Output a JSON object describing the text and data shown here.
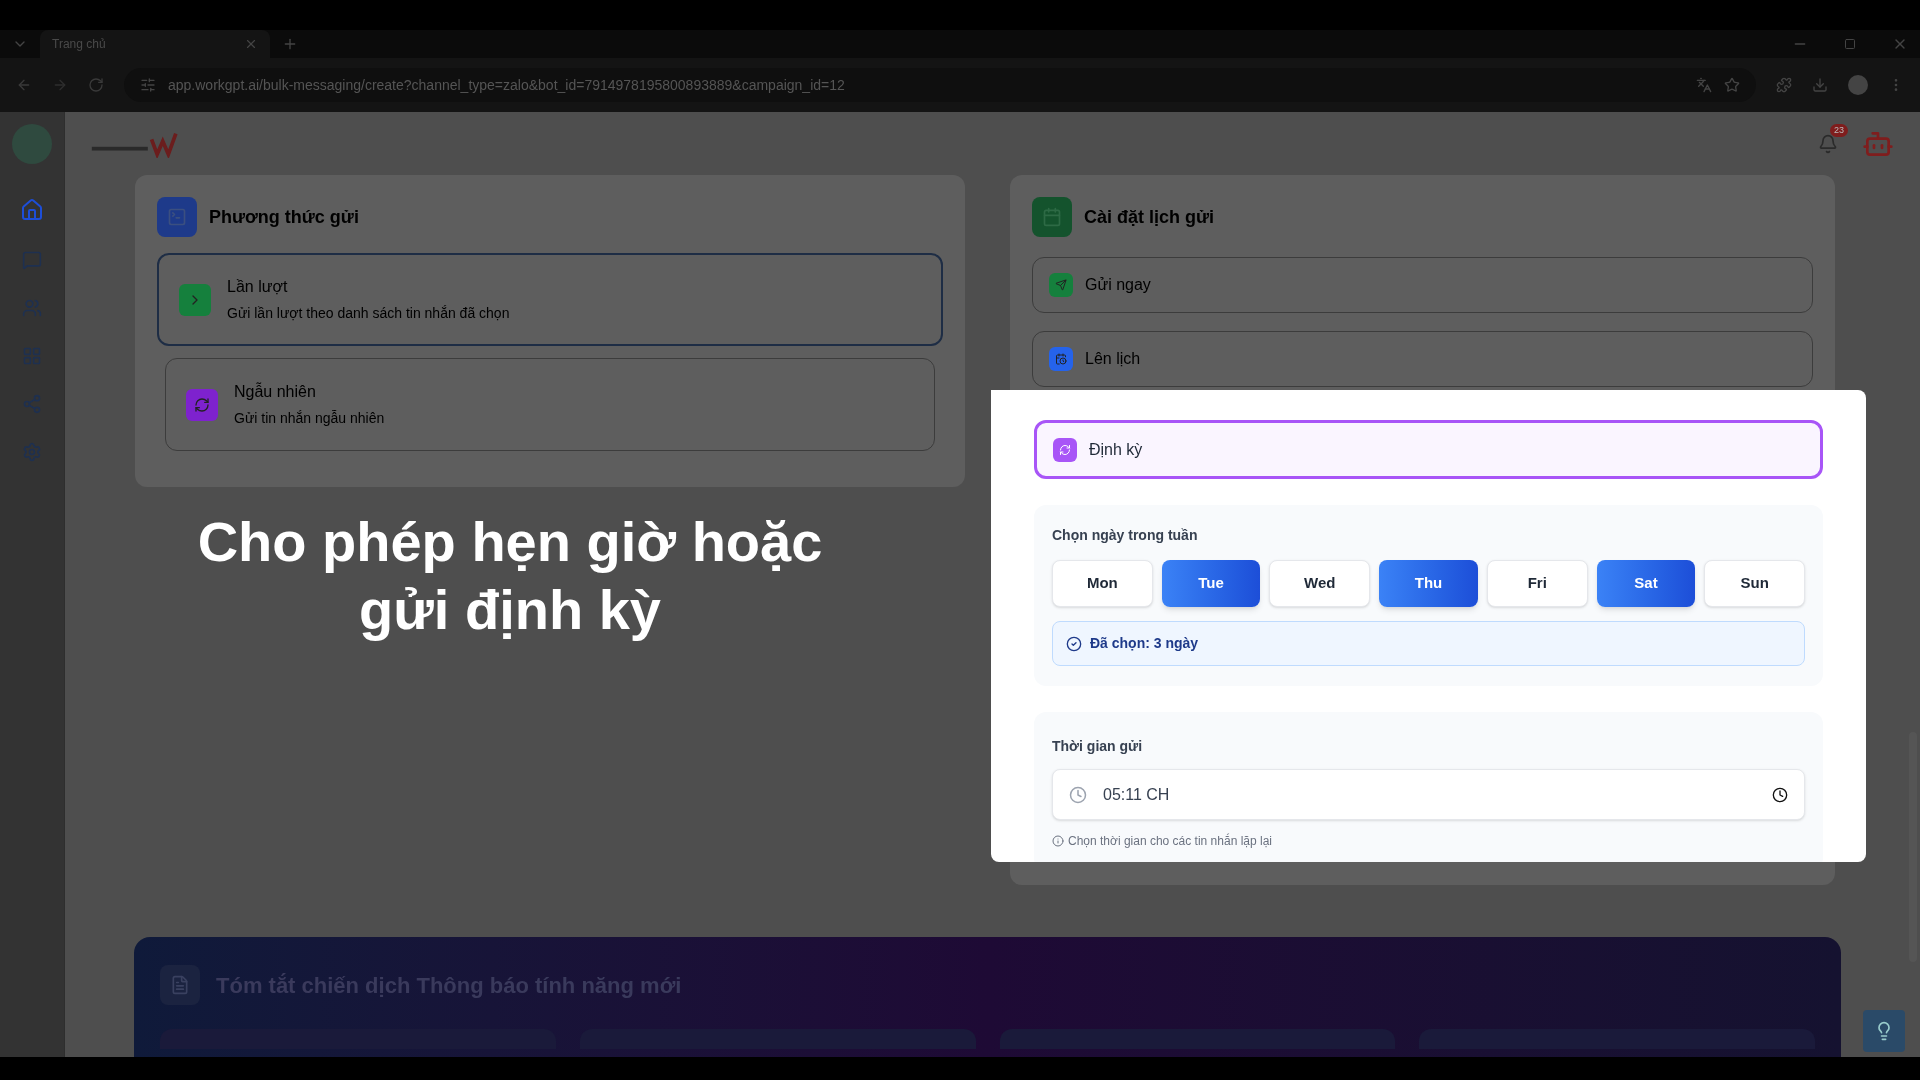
{
  "browser": {
    "tab_title": "Trang chủ",
    "url": "app.workgpt.ai/bulk-messaging/create?channel_type=zalo&bot_id=7914978195800893889&campaign_id=12"
  },
  "header": {
    "notification_count": "23"
  },
  "sidebar": {
    "items": [
      {
        "selected": true
      },
      {
        "selected": false
      },
      {
        "selected": false
      },
      {
        "selected": false
      },
      {
        "selected": false
      },
      {
        "selected": false
      }
    ]
  },
  "send_method": {
    "title": "Phương thức gửi",
    "options": [
      {
        "label": "Lần lượt",
        "description": "Gửi lần lượt theo danh sách tin nhắn đã chọn",
        "selected": true,
        "color": "#15803d"
      },
      {
        "label": "Ngẫu nhiên",
        "description": "Gửi tin nhắn ngẫu nhiên",
        "selected": false,
        "color": "#7e22ce"
      }
    ]
  },
  "schedule": {
    "title": "Cài đặt lịch gửi",
    "options": [
      {
        "label": "Gửi ngay",
        "selected": false,
        "color": "#15803d"
      },
      {
        "label": "Lên lịch",
        "selected": false,
        "color": "#2563eb"
      },
      {
        "label": "Định kỳ",
        "selected": true,
        "color": "#a855f7"
      }
    ],
    "weekdays": {
      "title": "Chọn ngày trong tuần",
      "days": [
        {
          "label": "Mon",
          "selected": false
        },
        {
          "label": "Tue",
          "selected": true
        },
        {
          "label": "Wed",
          "selected": false
        },
        {
          "label": "Thu",
          "selected": true
        },
        {
          "label": "Fri",
          "selected": false
        },
        {
          "label": "Sat",
          "selected": true
        },
        {
          "label": "Sun",
          "selected": false
        }
      ],
      "summary": "Đã chọn: 3 ngày"
    },
    "send_time": {
      "title": "Thời gian gửi",
      "value": "05:11 CH",
      "hint": "Chọn thời gian cho các tin nhắn lặp lại"
    }
  },
  "caption": "Cho phép hẹn giờ hoặc gửi định kỳ",
  "summary": {
    "title": "Tóm tắt chiến dịch Thông báo tính năng mới"
  }
}
